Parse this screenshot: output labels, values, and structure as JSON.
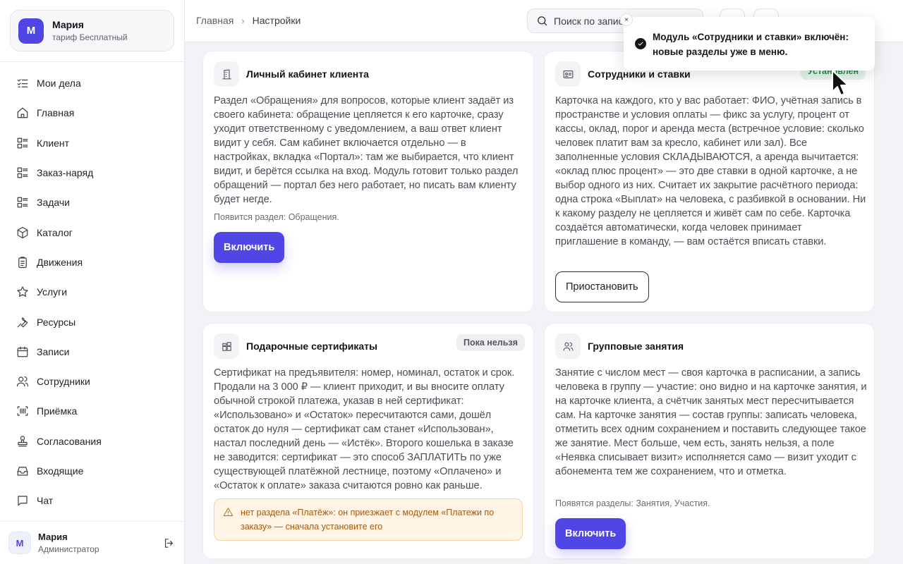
{
  "account": {
    "avatar": "М",
    "name": "Мария",
    "plan": "тариф Бесплатный"
  },
  "sidebar": {
    "items": [
      {
        "label": "Мои дела",
        "icon": "checklist-icon"
      },
      {
        "label": "Главная",
        "icon": "home-icon"
      },
      {
        "label": "Клиент",
        "icon": "list-icon"
      },
      {
        "label": "Заказ-наряд",
        "icon": "list-icon"
      },
      {
        "label": "Задачи",
        "icon": "list-icon"
      },
      {
        "label": "Каталог",
        "icon": "box-icon"
      },
      {
        "label": "Движения",
        "icon": "clipboard-icon"
      },
      {
        "label": "Услуги",
        "icon": "star-icon"
      },
      {
        "label": "Ресурсы",
        "icon": "wrench-icon"
      },
      {
        "label": "Записи",
        "icon": "calendar-icon"
      },
      {
        "label": "Сотрудники",
        "icon": "users-icon"
      },
      {
        "label": "Приёмка",
        "icon": "barcode-icon"
      },
      {
        "label": "Согласования",
        "icon": "stamp-icon"
      },
      {
        "label": "Входящие",
        "icon": "inbox-icon"
      },
      {
        "label": "Чат",
        "icon": "chat-icon"
      }
    ]
  },
  "user": {
    "avatar": "М",
    "name": "Мария",
    "role": "Администратор"
  },
  "breadcrumb": {
    "home": "Главная",
    "separator": "›",
    "current": "Настройки"
  },
  "search": {
    "placeholder": "Поиск по записям"
  },
  "cards": {
    "client_portal": {
      "title": "Личный кабинет клиента",
      "body": "Раздел «Обращения» для вопросов, которые клиент задаёт из своего кабинета: обращение цепляется к его карточке, сразу уходит ответственному с уведомлением, а ваш ответ клиент видит у себя. Сам кабинет включается отдельно — в настройках, вкладка «Портал»: там же выбирается, что клиент видит, и берётся ссылка на вход. Модуль готовит только раздел обращений — портал без него работает, но писать вам клиенту будет негде.",
      "note": "Появится раздел: Обращения.",
      "button": "Включить"
    },
    "staff_rates": {
      "title": "Сотрудники и ставки",
      "badge": "Установлен",
      "body": "Карточка на каждого, кто у вас работает: ФИО, учётная запись в пространстве и условия оплаты — фикс за услугу, процент от кассы, оклад, порог и аренда места (встречное условие: сколько человек платит вам за кресло, кабинет или зал). Все заполненные условия СКЛАДЫВАЮТСЯ, а аренда вычитается: «оклад плюс процент» — это две ставки в одной карточке, а не выбор одного из них. Считает их закрытие расчётного периода: одна строка «Выплат» на человека, с разбивкой в основании. Ни к какому разделу не цепляется и живёт сам по себе. Карточка создаётся автоматически, когда человек принимает приглашение в команду, — вам остаётся вписать ставки.",
      "button": "Приостановить"
    },
    "gift_certificates": {
      "title": "Подарочные сертификаты",
      "badge": "Пока нельзя",
      "body": "Сертификат на предъявителя: номер, номинал, остаток и срок. Продали на 3 000 ₽ — клиент приходит, и вы вносите оплату обычной строкой платежа, указав в ней сертификат: «Использовано» и «Остаток» пересчитаются сами, дошёл остаток до нуля — сертификат сам станет «Использован», настал последний день — «Истёк». Второго кошелька в заказе не заводится: сертификат — это способ ЗАПЛАТИТЬ по уже существующей платёжной лестнице, поэтому «Оплачено» и «Остаток к оплате» заказа считаются ровно как раньше.",
      "warning": "нет раздела «Платёж»: он приезжает с модулем «Платежи по заказу» — сначала установите его"
    },
    "group_classes": {
      "title": "Групповые занятия",
      "body": "Занятие с числом мест — своя карточка в расписании, а запись человека в группу — участие: оно видно и на карточке занятия, и на карточке клиента, а счётчик занятых мест пересчитывается сам. На карточке занятия — состав группы: записать человека, отметить всех одним сохранением и поставить следующее такое же занятие. Мест больше, чем есть, занять нельзя, а поле «Неявка списывает визит» исполняется само — визит уходит с абонемента тем же сохранением, что и отметка.",
      "note": "Появятся разделы: Занятия, Участия.",
      "button": "Включить"
    }
  },
  "toast": {
    "close": "×",
    "message": "Модуль «Сотрудники и ставки» включён: новые разделы уже в меню."
  },
  "colors": {
    "accent": "#4f46e5",
    "success": "#2c8a4b",
    "warning": "#c0771a"
  }
}
